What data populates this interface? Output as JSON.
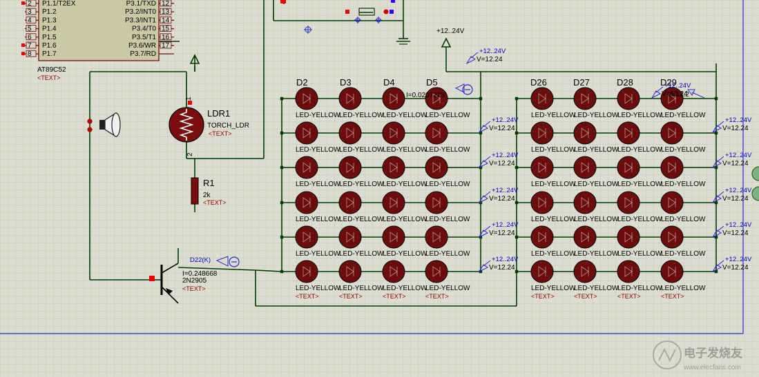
{
  "mcu": {
    "part": "AT89C52",
    "text": "<TEXT>",
    "left_pins": [
      {
        "num": "2",
        "name": "P1.1/T2EX"
      },
      {
        "num": "3",
        "name": "P1.2"
      },
      {
        "num": "4",
        "name": "P1.3"
      },
      {
        "num": "5",
        "name": "P1.4"
      },
      {
        "num": "6",
        "name": "P1.5"
      },
      {
        "num": "7",
        "name": "P1.6"
      },
      {
        "num": "8",
        "name": "P1.7"
      }
    ],
    "right_pins": [
      {
        "num": "12",
        "name": "P3.1/TXD"
      },
      {
        "num": "13",
        "name": "P3.2/INT0"
      },
      {
        "num": "14",
        "name": "P3.3/INT1"
      },
      {
        "num": "15",
        "name": "P3.4/T0"
      },
      {
        "num": "16",
        "name": "P3.5/T1"
      },
      {
        "num": "17",
        "name": "P3.6/WR"
      },
      {
        "num": "",
        "name": "P3.7/RD"
      }
    ]
  },
  "ldr": {
    "name": "LDR1",
    "part": "TORCH_LDR",
    "text": "<TEXT>",
    "pin1": "1",
    "pin2": "2"
  },
  "resistor": {
    "name": "R1",
    "value": "2k",
    "text": "<TEXT>"
  },
  "transistor": {
    "name": "2N2905",
    "text": "<TEXT>",
    "probe_name": "D22(K)",
    "probe_current": "I=0.248668"
  },
  "supply": {
    "label": "+12..24V"
  },
  "led_probe": {
    "name": "D5",
    "current": "I=0.0207223"
  },
  "voltage_probes": [
    {
      "label": "+12..24V",
      "value": "V=12.24"
    },
    {
      "label": "+12..24V",
      "value": "V=12.24"
    },
    {
      "label": "+12..24V",
      "value": "V=12.24"
    },
    {
      "label": "+12..24V",
      "value": "V=12.24"
    },
    {
      "label": "+12..24V",
      "value": "V=12.24"
    },
    {
      "label": "+12..24V",
      "value": "V=12.24"
    },
    {
      "label": "+12..24V",
      "value": "V=12.24"
    },
    {
      "label": "+12..24V",
      "value": "V=12.24"
    },
    {
      "label": "+12..24V",
      "value": "V=12.24"
    },
    {
      "label": "+12..24V",
      "value": "V=12.24"
    },
    {
      "label": "+12..24V",
      "value": "V=12.24"
    },
    {
      "label": "+12..24V",
      "value": "V=12.24"
    },
    {
      "label": "+12..24V",
      "value": "V=12.2"
    }
  ],
  "led_row_label": "LED-YELLOW",
  "led_text": "<TEXT>",
  "led_names_top_left": [
    "D2",
    "D3",
    "D4",
    "D5"
  ],
  "led_names_top_right": [
    "D26",
    "D27",
    "D28",
    "D29"
  ],
  "watermark": {
    "brand": "电子发烧友",
    "url": "www.elecfans.com"
  },
  "colors": {
    "grid": "#c6c6b4",
    "wire": "#003a00",
    "led": "#6b0d0d",
    "probe": "#0000c8",
    "text": "#8b0000",
    "frame": "#2a2acc"
  }
}
